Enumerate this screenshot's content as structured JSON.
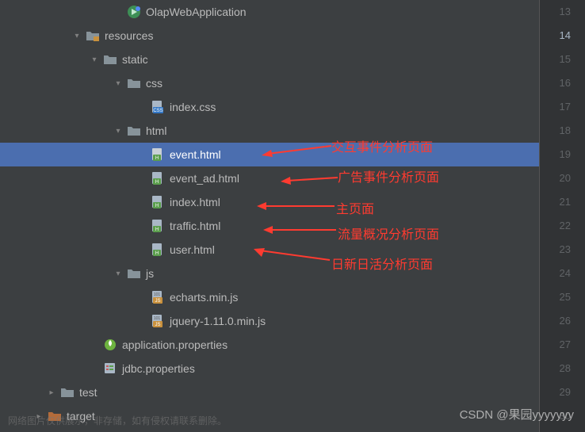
{
  "lineNumbers": {
    "start": 13,
    "end": 30,
    "current": 14
  },
  "tree": {
    "top": {
      "label": "OlapWebApplication"
    },
    "resources": {
      "label": "resources"
    },
    "static": {
      "label": "static"
    },
    "css": {
      "label": "css"
    },
    "index_css": {
      "label": "index.css"
    },
    "html": {
      "label": "html"
    },
    "event_html": {
      "label": "event.html"
    },
    "event_ad_html": {
      "label": "event_ad.html"
    },
    "index_html": {
      "label": "index.html"
    },
    "traffic_html": {
      "label": "traffic.html"
    },
    "user_html": {
      "label": "user.html"
    },
    "js": {
      "label": "js"
    },
    "echarts_js": {
      "label": "echarts.min.js"
    },
    "jquery_js": {
      "label": "jquery-1.11.0.min.js"
    },
    "app_props": {
      "label": "application.properties"
    },
    "jdbc_props": {
      "label": "jdbc.properties"
    },
    "test": {
      "label": "test"
    },
    "target": {
      "label": "target"
    }
  },
  "annotations": {
    "event": "交互事件分析页面",
    "event_ad": "广告事件分析页面",
    "index": "主页面",
    "traffic": "流量概况分析页面",
    "user": "日新日活分析页面"
  },
  "watermark": {
    "bottom": "网络图片仅供展示，非存储，如有侵权请联系删除。",
    "csdn": "CSDN @果园yyyyyyy"
  }
}
